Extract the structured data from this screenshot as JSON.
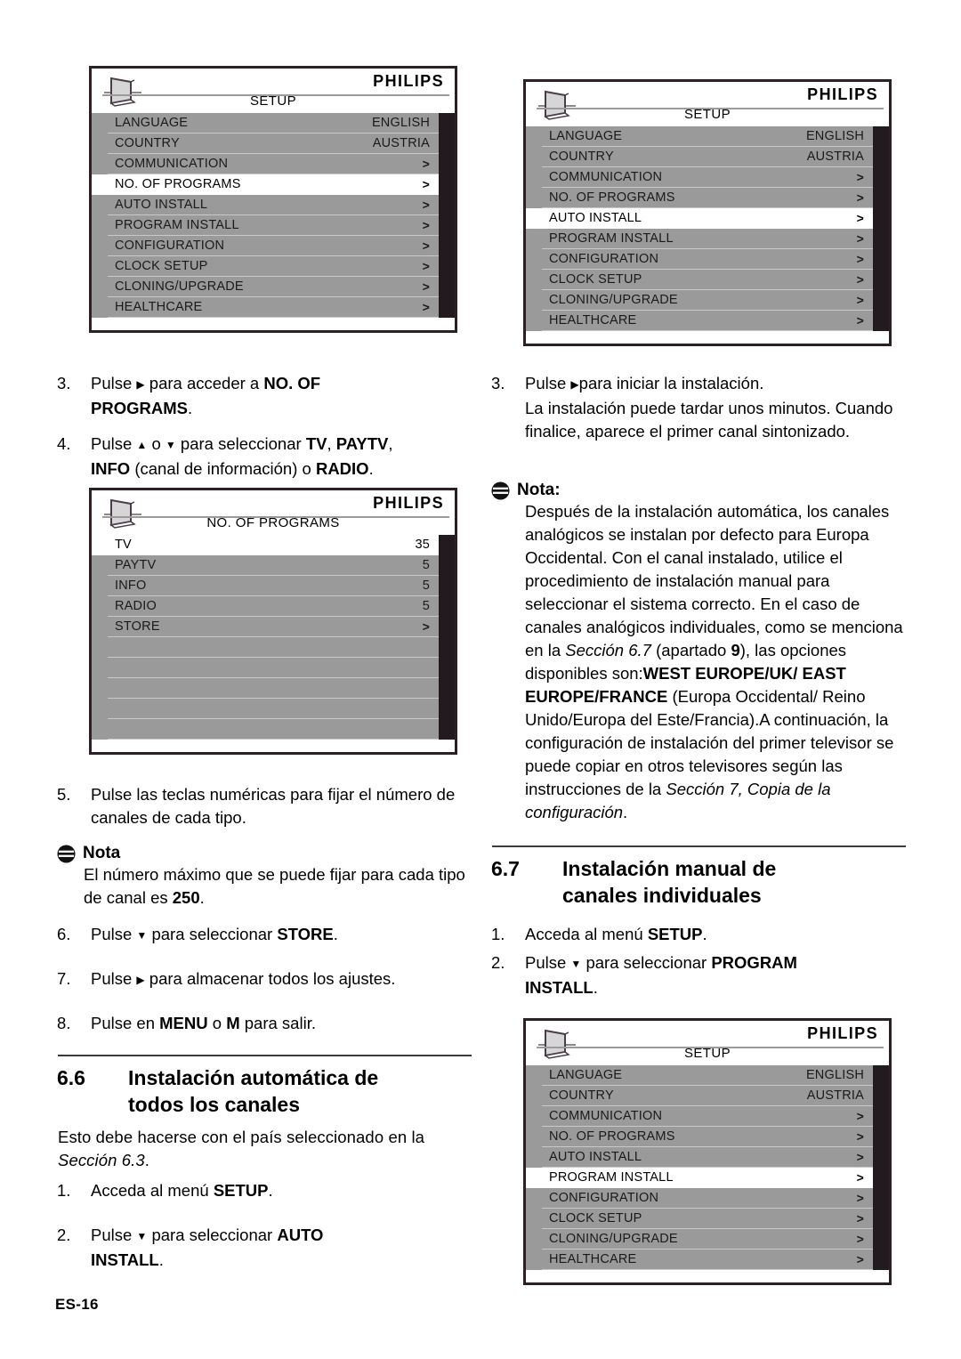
{
  "footer": {
    "page_label": "ES-16"
  },
  "osd_setup_no_of_programs": {
    "brand": "PHILIPS",
    "title": "SETUP",
    "rows": [
      {
        "label": "LANGUAGE",
        "value": "ENGLISH",
        "selected": false
      },
      {
        "label": "COUNTRY",
        "value": "AUSTRIA",
        "selected": false
      },
      {
        "label": "COMMUNICATION",
        "value": ">",
        "selected": false
      },
      {
        "label": "NO. OF PROGRAMS",
        "value": ">",
        "selected": true
      },
      {
        "label": "AUTO INSTALL",
        "value": ">",
        "selected": false
      },
      {
        "label": "PROGRAM INSTALL",
        "value": ">",
        "selected": false
      },
      {
        "label": "CONFIGURATION",
        "value": ">",
        "selected": false
      },
      {
        "label": "CLOCK SETUP",
        "value": ">",
        "selected": false
      },
      {
        "label": "CLONING/UPGRADE",
        "value": ">",
        "selected": false
      },
      {
        "label": "HEALTHCARE",
        "value": ">",
        "selected": false
      }
    ]
  },
  "osd_setup_auto_install": {
    "brand": "PHILIPS",
    "title": "SETUP",
    "rows": [
      {
        "label": "LANGUAGE",
        "value": "ENGLISH",
        "selected": false
      },
      {
        "label": "COUNTRY",
        "value": "AUSTRIA",
        "selected": false
      },
      {
        "label": "COMMUNICATION",
        "value": ">",
        "selected": false
      },
      {
        "label": "NO. OF PROGRAMS",
        "value": ">",
        "selected": false
      },
      {
        "label": "AUTO INSTALL",
        "value": ">",
        "selected": true
      },
      {
        "label": "PROGRAM INSTALL",
        "value": ">",
        "selected": false
      },
      {
        "label": "CONFIGURATION",
        "value": ">",
        "selected": false
      },
      {
        "label": "CLOCK SETUP",
        "value": ">",
        "selected": false
      },
      {
        "label": "CLONING/UPGRADE",
        "value": ">",
        "selected": false
      },
      {
        "label": "HEALTHCARE",
        "value": ">",
        "selected": false
      }
    ]
  },
  "osd_no_of_programs": {
    "brand": "PHILIPS",
    "title": "NO. OF PROGRAMS",
    "rows": [
      {
        "label": "TV",
        "value": "35",
        "selected": true
      },
      {
        "label": "PAYTV",
        "value": "5",
        "selected": false
      },
      {
        "label": "INFO",
        "value": "5",
        "selected": false
      },
      {
        "label": "RADIO",
        "value": "5",
        "selected": false
      },
      {
        "label": "STORE",
        "value": ">",
        "selected": false
      },
      {
        "label": "",
        "value": "",
        "selected": false
      },
      {
        "label": "",
        "value": "",
        "selected": false
      },
      {
        "label": "",
        "value": "",
        "selected": false
      },
      {
        "label": "",
        "value": "",
        "selected": false
      },
      {
        "label": "",
        "value": "",
        "selected": false
      }
    ]
  },
  "osd_setup_program_install": {
    "brand": "PHILIPS",
    "title": "SETUP",
    "rows": [
      {
        "label": "LANGUAGE",
        "value": "ENGLISH",
        "selected": false
      },
      {
        "label": "COUNTRY",
        "value": "AUSTRIA",
        "selected": false
      },
      {
        "label": "COMMUNICATION",
        "value": ">",
        "selected": false
      },
      {
        "label": "NO. OF PROGRAMS",
        "value": ">",
        "selected": false
      },
      {
        "label": "AUTO INSTALL",
        "value": ">",
        "selected": false
      },
      {
        "label": "PROGRAM INSTALL",
        "value": ">",
        "selected": true
      },
      {
        "label": "CONFIGURATION",
        "value": ">",
        "selected": false
      },
      {
        "label": "CLOCK SETUP",
        "value": ">",
        "selected": false
      },
      {
        "label": "CLONING/UPGRADE",
        "value": ">",
        "selected": false
      },
      {
        "label": "HEALTHCARE",
        "value": ">",
        "selected": false
      }
    ]
  },
  "left_column": {
    "step3": {
      "num": "3.",
      "text_a": "Pulse ",
      "text_b": " para acceder a ",
      "bold_a": "NO. OF",
      "bold_b": "PROGRAMS",
      "text_c": "."
    },
    "step4": {
      "num": "4.",
      "text_a": "Pulse ",
      "text_b": " o ",
      "text_c": " para seleccionar ",
      "bold_a": "TV",
      "sep1": ", ",
      "bold_b": "PAYTV",
      "sep2": ",",
      "bold_c": "INFO",
      "text_d": " (canal de información) o ",
      "bold_d": "RADIO",
      "text_e": "."
    },
    "step5": {
      "num": "5.",
      "text": "Pulse las teclas numéricas para fijar el número de canales de cada tipo."
    },
    "note": {
      "title": "Nota",
      "text_a": "El número máximo que se puede fijar para cada tipo de canal es ",
      "bold_a": "250",
      "text_b": "."
    },
    "step6": {
      "num": "6.",
      "text_a": "Pulse ",
      "text_b": " para seleccionar ",
      "bold_a": "STORE",
      "text_c": "."
    },
    "step7": {
      "num": "7.",
      "text_a": "Pulse ",
      "text_b": " para almacenar todos los ajustes."
    },
    "step8": {
      "num": "8.",
      "text_a": "Pulse en ",
      "bold_a": "MENU",
      "text_b": " o ",
      "bold_b": "M",
      "text_c": " para salir."
    },
    "section": {
      "number": "6.6",
      "title_line1": "Instalación automática de",
      "title_line2": "todos los canales",
      "intro_a": "Esto debe hacerse con el país seleccionado en la ",
      "intro_italic": "Sección 6.3",
      "intro_b": ".",
      "step1": {
        "num": "1.",
        "text_a": "Acceda al menú ",
        "bold_a": "SETUP",
        "text_b": "."
      },
      "step2": {
        "num": "2.",
        "text_a": "Pulse ",
        "text_b": " para seleccionar ",
        "bold_a": "AUTO",
        "bold_b": "INSTALL",
        "text_c": "."
      }
    }
  },
  "right_column": {
    "step3": {
      "num": "3.",
      "text_a": "Pulse ",
      "text_b": "para iniciar la instalación.",
      "text_c": "La instalación puede tardar unos minutos. Cuando finalice, aparece el primer canal sintonizado."
    },
    "note": {
      "title": "Nota:",
      "text_a": "Después de la instalación automática, los canales analógicos se instalan por defecto para Europa Occidental. Con el canal instalado, utilice el procedimiento de instalación manual para seleccionar el sistema correcto. En el caso de canales analógicos individuales, como se menciona en la ",
      "italic_a": "Sección 6.7",
      "text_b": " (apartado ",
      "bold_a": "9",
      "text_c": "), las opciones disponibles son:",
      "bold_b": "WEST EUROPE/UK/ EAST EUROPE/FRANCE",
      "text_d": " (Europa Occidental/ Reino Unido/Europa del Este/Francia).",
      "text_e": "A continuación, la configuración de instalación del primer televisor se puede copiar en otros televisores según las instrucciones de la ",
      "italic_b": "Sección 7, Copia de la configuración",
      "text_f": "."
    },
    "section": {
      "number": "6.7",
      "title_line1": "Instalación manual de",
      "title_line2": "canales individuales",
      "step1": {
        "num": "1.",
        "text_a": "Acceda al menú ",
        "bold_a": "SETUP",
        "text_b": "."
      },
      "step2": {
        "num": "2.",
        "text_a": "Pulse ",
        "text_b": " para seleccionar ",
        "bold_a": "PROGRAM",
        "bold_b": "INSTALL",
        "text_c": "."
      }
    }
  }
}
